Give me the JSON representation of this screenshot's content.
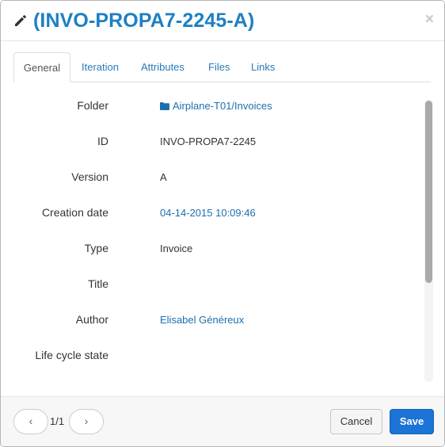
{
  "header": {
    "title": "(INVO-PROPA7-2245-A)",
    "edit_icon": "pencil-icon",
    "close_label": "×"
  },
  "tabs": [
    {
      "label": "General",
      "active": true
    },
    {
      "label": "Iteration",
      "active": false
    },
    {
      "label": "Attributes",
      "active": false
    },
    {
      "label": "Files",
      "active": false
    },
    {
      "label": "Links",
      "active": false
    }
  ],
  "fields": {
    "folder": {
      "label": "Folder",
      "value": "Airplane-T01/Invoices",
      "icon": "folder-icon"
    },
    "id": {
      "label": "ID",
      "value": "INVO-PROPA7-2245"
    },
    "version": {
      "label": "Version",
      "value": "A"
    },
    "creation_date": {
      "label": "Creation date",
      "value": "04-14-2015 10:09:46"
    },
    "type": {
      "label": "Type",
      "value": "Invoice"
    },
    "title": {
      "label": "Title",
      "value": ""
    },
    "author": {
      "label": "Author",
      "value": "Elisabel Généreux"
    },
    "lifecycle": {
      "label": "Life cycle state",
      "value": ""
    }
  },
  "footer": {
    "prev_label": "‹",
    "next_label": "›",
    "page_count": "1/1",
    "cancel_label": "Cancel",
    "save_label": "Save"
  },
  "colors": {
    "accent": "#1d80c3",
    "link": "#1d6fae",
    "primary_button": "#1b74d6"
  }
}
